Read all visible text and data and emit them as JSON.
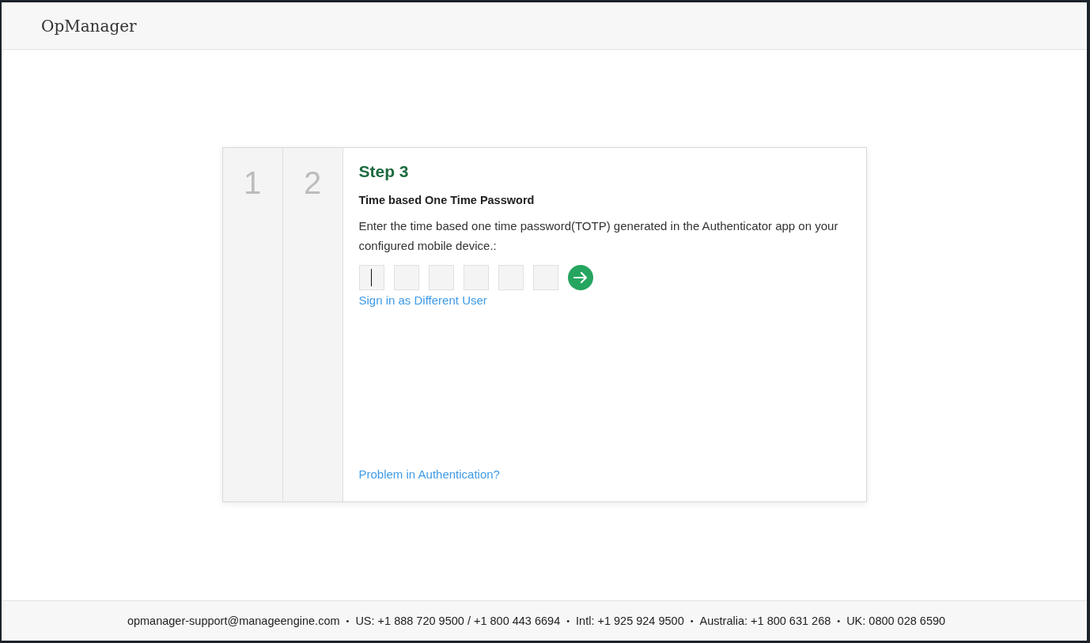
{
  "header": {
    "title": "OpManager"
  },
  "steps": [
    {
      "label": "1"
    },
    {
      "label": "2"
    }
  ],
  "panel": {
    "title": "Step 3",
    "subtitle": "Time based One Time Password",
    "instructions": "Enter the time based one time password(TOTP) generated in the Authenticator app on your configured mobile device.:",
    "otp_fields": [
      {
        "focused": true
      },
      {
        "focused": false
      },
      {
        "focused": false
      },
      {
        "focused": false
      },
      {
        "focused": false
      },
      {
        "focused": false
      }
    ],
    "links": [
      "Sign in as Different User",
      "Problem in Authentication?"
    ]
  },
  "footer": {
    "contacts": [
      "opmanager-support@manageengine.com",
      "US: +1 888 720 9500 / +1 800 443 6694",
      "Intl: +1 925 924 9500",
      "Australia: +1 800 631 268",
      "UK: 0800 028 6590"
    ],
    "separator": "•"
  }
}
